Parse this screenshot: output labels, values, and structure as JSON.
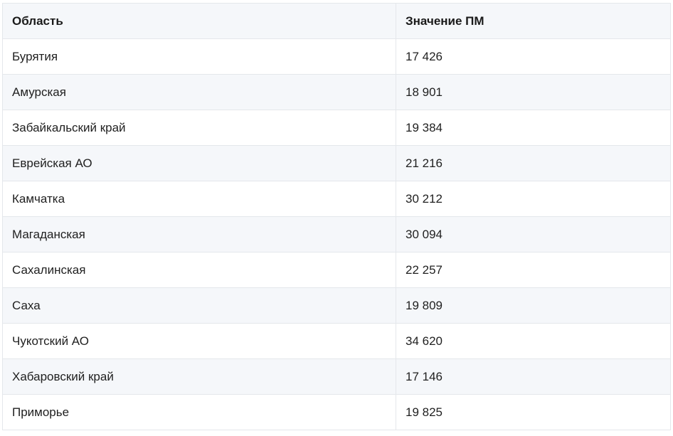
{
  "table": {
    "headers": [
      "Область",
      "Значение ПМ"
    ],
    "rows": [
      [
        "Бурятия",
        "17 426"
      ],
      [
        "Амурская",
        "18 901"
      ],
      [
        "Забайкальский край",
        "19 384"
      ],
      [
        "Еврейская АО",
        "21 216"
      ],
      [
        "Камчатка",
        "30 212"
      ],
      [
        "Магаданская",
        "30 094"
      ],
      [
        "Сахалинская",
        "22 257"
      ],
      [
        "Саха",
        "19 809"
      ],
      [
        "Чукотский АО",
        "34 620"
      ],
      [
        "Хабаровский край",
        "17 146"
      ],
      [
        "Приморье",
        "19 825"
      ]
    ]
  }
}
